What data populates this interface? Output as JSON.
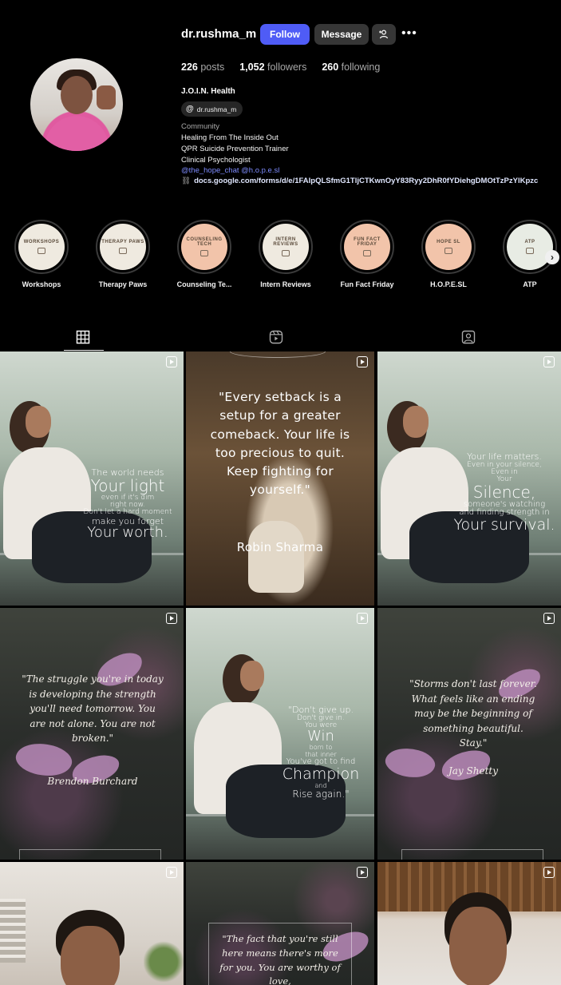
{
  "profile": {
    "username": "dr.rushma_m",
    "follow_label": "Follow",
    "message_label": "Message",
    "suggest_label": "+👤",
    "more_label": "•••",
    "stats": {
      "posts_count": "226",
      "posts_label": "posts",
      "followers_count": "1,052",
      "followers_label": "followers",
      "following_count": "260",
      "following_label": "following"
    },
    "display_name": "J.O.I.N. Health",
    "threads_handle": "dr.rushma_m",
    "category": "Community",
    "bio_line_1": "Healing From The Inside Out",
    "bio_line_2": "QPR Suicide Prevention Trainer",
    "bio_line_3": "Clinical Psychologist",
    "mentions": "@the_hope_chat @h.o.p.e.sl",
    "link": "docs.google.com/forms/d/e/1FAIpQLSfmG1TljCTKwnOyY83Ryy2DhR0fYDiehgDMOtTzPzYlKpzc"
  },
  "highlights": [
    {
      "label": "Workshops",
      "badge": "WORKSHOPS",
      "color": "#efeae0"
    },
    {
      "label": "Therapy Paws",
      "badge": "THERAPY PAWS",
      "color": "#efeae0"
    },
    {
      "label": "Counseling Te...",
      "badge": "COUNSELING TECH",
      "color": "#f2c4aa"
    },
    {
      "label": "Intern Reviews",
      "badge": "INTERN REVIEWS",
      "color": "#efeae0"
    },
    {
      "label": "Fun Fact Friday",
      "badge": "FUN FACT FRIDAY",
      "color": "#f2c4aa"
    },
    {
      "label": "H.O.P.E.SL",
      "badge": "HOPE SL",
      "color": "#f2c4aa"
    },
    {
      "label": "ATP",
      "badge": "ATP",
      "color": "#e8ece4"
    }
  ],
  "tabs": {
    "posts": "grid-icon",
    "reels": "reels-icon",
    "tagged": "tagged-icon"
  },
  "posts": {
    "p1": {
      "line1": "The world needs",
      "line2": "Your light",
      "line3": "even if it's dim",
      "line4": "right now.",
      "line5": "Don't let a hard moment",
      "line6": "make you forget",
      "line7": "Your worth."
    },
    "p2": {
      "quote": "\"Every setback is a setup for a greater comeback. Your life is too precious to quit. Keep fighting for yourself.\"",
      "author": "Robin Sharma"
    },
    "p3": {
      "line1": "Your life matters.",
      "line2": "Even in your silence,",
      "line3": "Even in",
      "line4": "Your",
      "line5": "Silence,",
      "line6": "someone's watching",
      "line7": "and finding strength in",
      "line8": "Your survival."
    },
    "p4": {
      "quote": "\"The struggle you're in today is developing the strength you'll need tomorrow. You are not alone. You are not broken.\"",
      "author": "Brendon Burchard"
    },
    "p5": {
      "line1": "\"Don't give up.",
      "line2": "Don't give in.",
      "line3": "You were",
      "line4": "Win",
      "line5": "born to",
      "line6": "that inner",
      "line7": "You've got to find",
      "line8": "Champion",
      "line9": "and",
      "line10": "Rise again.\""
    },
    "p6": {
      "quote": "\"Storms don't last forever. What feels like an ending may be the beginning of something beautiful. Stay.\"",
      "author": "Jay Shetty"
    },
    "p8": {
      "quote": "\"The fact that you're still here means there's more for you. You are worthy of love,"
    }
  }
}
